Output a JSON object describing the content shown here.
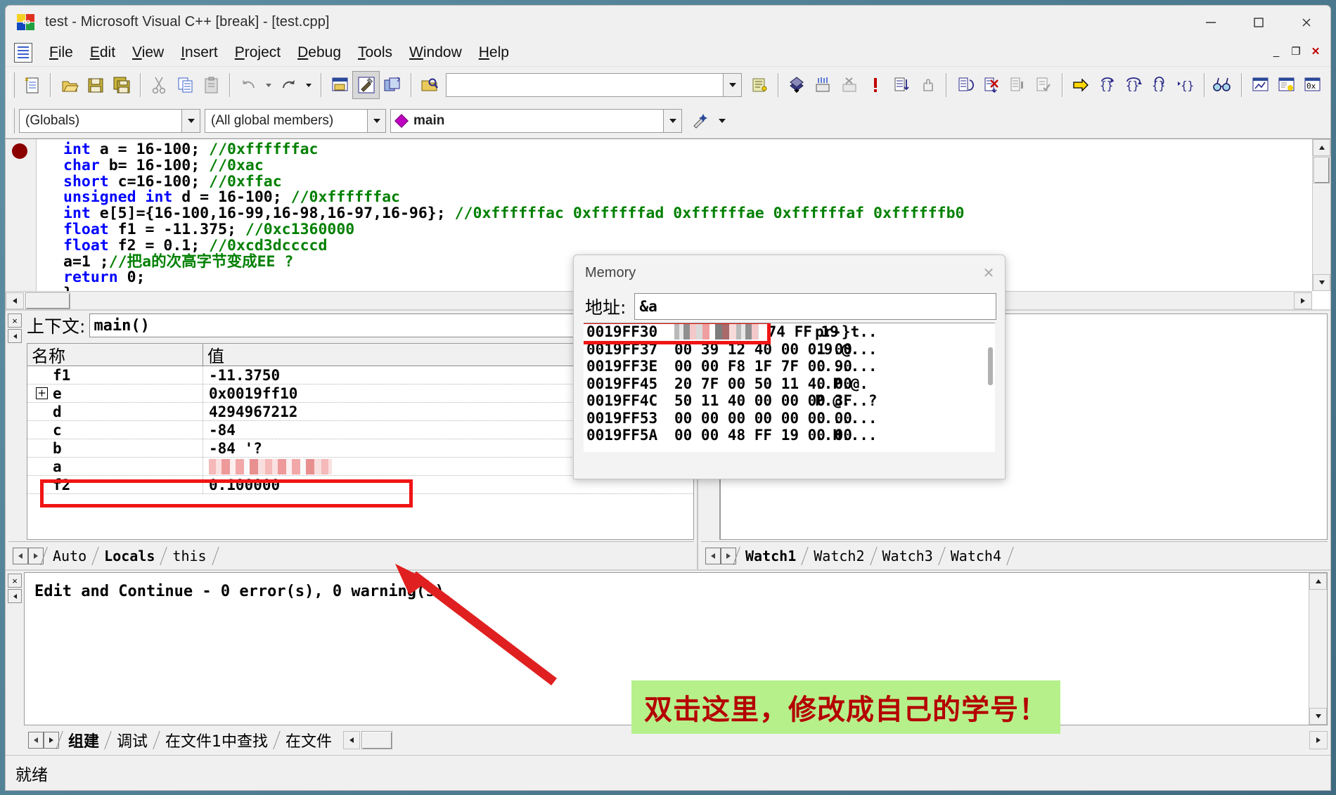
{
  "window": {
    "title": "test - Microsoft Visual C++ [break] - [test.cpp]",
    "minimize": "—",
    "maximize": "☐",
    "close": "✕"
  },
  "menu": {
    "items": [
      {
        "label": "File",
        "accel": "F"
      },
      {
        "label": "Edit",
        "accel": "E"
      },
      {
        "label": "View",
        "accel": "V"
      },
      {
        "label": "Insert",
        "accel": "I"
      },
      {
        "label": "Project",
        "accel": "P"
      },
      {
        "label": "Debug",
        "accel": "D"
      },
      {
        "label": "Tools",
        "accel": "T"
      },
      {
        "label": "Window",
        "accel": "W"
      },
      {
        "label": "Help",
        "accel": "H"
      }
    ],
    "mdi": {
      "restore": "_",
      "maximize": "❐",
      "close": "✕"
    }
  },
  "toolbar1": {
    "find_box_value": "",
    "icons": [
      "new-document-icon",
      "open-folder-icon",
      "save-icon",
      "save-all-icon",
      "cut-icon",
      "copy-icon",
      "paste-icon",
      "undo-icon",
      "redo-icon",
      "workspace-icon",
      "build-icon",
      "compile-icon",
      "find-in-files-icon",
      "toggle-breakpoint-icon",
      "insert-remove-breakpoint-icon",
      "disable-breakpoint-icon",
      "stop-debug-icon",
      "step-out-icon",
      "hand-icon",
      "restart-icon",
      "stop-debugging-icon",
      "break-execution-icon",
      "apply-code-changes-icon",
      "show-next-statement-icon",
      "step-into-icon",
      "step-over-icon",
      "step-out2-icon",
      "run-to-cursor-icon",
      "quickwatch-icon",
      "watch-window-icon",
      "variables-window-icon",
      "registers-window-icon"
    ]
  },
  "toolbar2": {
    "globals_value": "(Globals)",
    "members_value": "(All global members)",
    "function_value": "main",
    "wizard_icon": "wizardbar-icon"
  },
  "editor": {
    "breakpoint_line": 1,
    "current_line": 9,
    "lines": [
      [
        {
          "t": "kw",
          "s": "int"
        },
        {
          "t": "pl",
          "s": " a = 16-100; "
        },
        {
          "t": "cm",
          "s": "//0xffffffac"
        }
      ],
      [
        {
          "t": "kw",
          "s": "char"
        },
        {
          "t": "pl",
          "s": " b= 16-100; "
        },
        {
          "t": "cm",
          "s": "//0xac"
        }
      ],
      [
        {
          "t": "kw",
          "s": "short"
        },
        {
          "t": "pl",
          "s": " c=16-100; "
        },
        {
          "t": "cm",
          "s": "//0xffac"
        }
      ],
      [
        {
          "t": "kw",
          "s": "unsigned int"
        },
        {
          "t": "pl",
          "s": " d = 16-100; "
        },
        {
          "t": "cm",
          "s": "//0xffffffac"
        }
      ],
      [
        {
          "t": "kw",
          "s": "int"
        },
        {
          "t": "pl",
          "s": " e[5]={16-100,16-99,16-98,16-97,16-96}; "
        },
        {
          "t": "cm",
          "s": "//0xffffffac 0xffffffad 0xffffffae 0xffffffaf 0xffffffb0"
        }
      ],
      [
        {
          "t": "kw",
          "s": "float"
        },
        {
          "t": "pl",
          "s": " f1 = -11.375; "
        },
        {
          "t": "cm",
          "s": "//0xc1360000"
        }
      ],
      [
        {
          "t": "kw",
          "s": "float"
        },
        {
          "t": "pl",
          "s": " f2 = 0.1; "
        },
        {
          "t": "cm",
          "s": "//0xcd3dccccd"
        }
      ],
      [
        {
          "t": "pl",
          "s": "a=1 ;"
        },
        {
          "t": "cm",
          "s": "//把a的次高字节变成EE ?"
        }
      ],
      [
        {
          "t": "kw",
          "s": "return"
        },
        {
          "t": "pl",
          "s": " 0;"
        }
      ],
      [
        {
          "t": "pl",
          "s": "}"
        }
      ]
    ]
  },
  "memory_window": {
    "title": "Memory",
    "close_label": "✕",
    "address_label": "地址:",
    "address_value": "&a",
    "rows": [
      {
        "addr": "0019FF30",
        "bytes": "",
        "redacted": true,
        "tail_bytes": "74 FF 19",
        "ascii": "pr-}t.."
      },
      {
        "addr": "0019FF37",
        "bytes": "00 39 12 40 00 01 00",
        "redacted": false,
        "ascii": ".9.@..."
      },
      {
        "addr": "0019FF3E",
        "bytes": "00 00 F8 1F 7F 00 90",
        "redacted": false,
        "ascii": "......."
      },
      {
        "addr": "0019FF45",
        "bytes": "20 7F 00 50 11 40 00",
        "redacted": false,
        "ascii": "..P.@."
      },
      {
        "addr": "0019FF4C",
        "bytes": "50 11 40 00 00 00 3F",
        "redacted": false,
        "ascii": "P.@...?"
      },
      {
        "addr": "0019FF53",
        "bytes": "00 00 00 00 00 00 00",
        "redacted": false,
        "ascii": "......."
      },
      {
        "addr": "0019FF5A",
        "bytes": "00 00 48 FF 19 00 00",
        "redacted": false,
        "ascii": "..H...."
      }
    ]
  },
  "variables_pane": {
    "context_label": "上下文:",
    "context_value": "main()",
    "columns": [
      "名称",
      "值"
    ],
    "rows": [
      {
        "name": "f1",
        "value": "-11.3750",
        "expandable": false,
        "redacted": false
      },
      {
        "name": "e",
        "value": "0x0019ff10",
        "expandable": true,
        "redacted": false
      },
      {
        "name": "d",
        "value": "4294967212",
        "expandable": false,
        "redacted": false
      },
      {
        "name": "c",
        "value": "-84",
        "expandable": false,
        "redacted": false
      },
      {
        "name": "b",
        "value": "-84 '?",
        "expandable": false,
        "redacted": false
      },
      {
        "name": "a",
        "value": "",
        "expandable": false,
        "redacted": true
      },
      {
        "name": "f2",
        "value": "0.100000",
        "expandable": false,
        "redacted": false
      }
    ],
    "tabs": [
      {
        "label": "Auto",
        "active": false
      },
      {
        "label": "Locals",
        "active": true
      },
      {
        "label": "this",
        "active": false
      }
    ]
  },
  "watch_pane": {
    "tabs": [
      {
        "label": "Watch1",
        "active": true
      },
      {
        "label": "Watch2",
        "active": false
      },
      {
        "label": "Watch3",
        "active": false
      },
      {
        "label": "Watch4",
        "active": false
      }
    ]
  },
  "output_pane": {
    "text": "Edit and Continue - 0 error(s), 0 warning(s)",
    "tabs": [
      {
        "label": "组建",
        "active": true
      },
      {
        "label": "调试",
        "active": false
      },
      {
        "label": "在文件1中查找",
        "active": false
      },
      {
        "label": "在文件",
        "active": false
      }
    ]
  },
  "annotation": {
    "text": "双击这里，修改成自己的学号！",
    "background": "#b6f08a",
    "color": "#b40000",
    "arrow_color": "#e02020"
  },
  "statusbar": {
    "text": "就绪"
  }
}
